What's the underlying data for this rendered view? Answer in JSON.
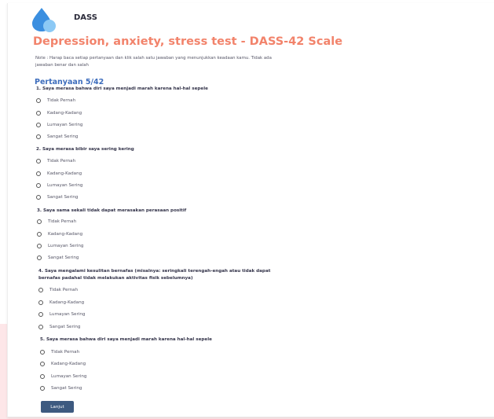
{
  "colors": {
    "accent": "#f2836b",
    "primary": "#3d6dbd",
    "button": "#3d5a80",
    "pink_band": "#fde6e8"
  },
  "header": {
    "logo_icon": "water-drop-logo-icon",
    "brand": "DASS"
  },
  "title": "Depression, anxiety, stress test - DASS-42 Scale",
  "note": "Note : Harap baca setiap pertanyaan dan klik salah satu jawaban yang menunjukkan keadaan kamu. Tidak ada jawaban benar dan salah",
  "progress": "Pertanyaan 5/42",
  "questions": [
    {
      "text": "1. Saya merasa bahwa diri saya menjadi marah karena hal-hal sepele",
      "options": [
        "Tidak Pernah",
        "Kadang-Kadang",
        "Lumayan Sering",
        "Sangat Sering"
      ]
    },
    {
      "text": "2. Saya merasa bibir saya sering kering",
      "options": [
        "Tidak Pernah",
        "Kadang-Kadang",
        "Lumayan Sering",
        "Sangat Sering"
      ]
    },
    {
      "text": "3. Saya sama sekali tidak dapat merasakan perasaan positif",
      "options": [
        "Tidak Pernah",
        "Kadang-Kadang",
        "Lumayan Sering",
        "Sangat Sering"
      ]
    },
    {
      "text": "4. Saya mengalami kesulitan bernafas (misalnya: seringkali terengah-engah atau tidak dapat bernafas padahal tidak melakukan aktivitas fisik sebelumnya)",
      "options": [
        "Tidak Pernah",
        "Kadang-Kadang",
        "Lumayan Sering",
        "Sangat Sering"
      ]
    },
    {
      "text": "5. Saya merasa bahwa diri saya menjadi marah karena hal-hal sepele",
      "options": [
        "Tidak Pernah",
        "Kadang-Kadang",
        "Lumayan Sering",
        "Sangat Sering"
      ]
    }
  ],
  "submit_label": "Lanjut"
}
